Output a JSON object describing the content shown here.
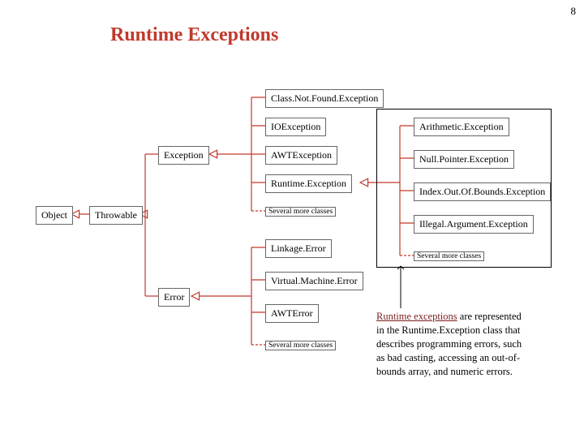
{
  "page_number": "8",
  "title": "Runtime Exceptions",
  "boxes": {
    "object": "Object",
    "throwable": "Throwable",
    "exception": "Exception",
    "error": "Error",
    "classnotfound": "Class.Not.Found.Exception",
    "ioexception": "IOException",
    "awtexception": "AWTException",
    "runtimeexception": "Runtime.Exception",
    "caption_exc": "Several more classes",
    "linkageerror": "Linkage.Error",
    "virtualmachineerror": "Virtual.Machine.Error",
    "awterror": "AWTError",
    "caption_err": "Several more classes",
    "arithmetic": "Arithmetic.Exception",
    "nullpointer": "Null.Pointer.Exception",
    "indexoob": "Index.Out.Of.Bounds.Exception",
    "illegalarg": "Illegal.Argument.Exception",
    "caption_rt": "Several more classes"
  },
  "description": {
    "lead": "Runtime exceptions",
    "rest": " are represented in the Runtime.Exception class that describes programming errors, such as bad casting, accessing an out-of-bounds array, and numeric errors."
  },
  "colors": {
    "connector": "#c0392b"
  }
}
